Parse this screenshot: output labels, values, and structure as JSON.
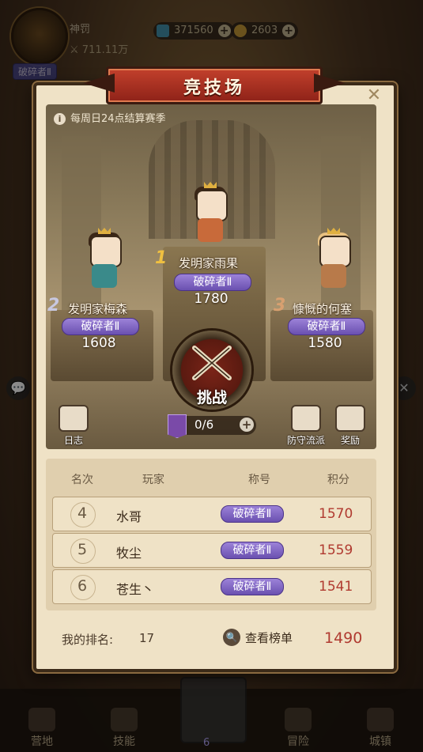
{
  "hud": {
    "player_name": "神罚",
    "power": "711.11万",
    "rank_badge": "破碎者Ⅱ",
    "gems": "371560",
    "coins": "2603"
  },
  "dialog": {
    "title": "竞技场",
    "close_symbol": "✕",
    "season_note": "每周日24点结算赛季",
    "podium": [
      {
        "place": "1",
        "name": "发明家雨果",
        "title": "破碎者Ⅱ",
        "score": "1780"
      },
      {
        "place": "2",
        "name": "发明家梅森",
        "title": "破碎者Ⅱ",
        "score": "1608"
      },
      {
        "place": "3",
        "name": "慷慨的何塞",
        "title": "破碎者Ⅱ",
        "score": "1580"
      }
    ],
    "challenge_label": "挑战",
    "tickets": "0/6",
    "log_label": "日志",
    "defense_label": "防守流派",
    "reward_label": "奖励",
    "table": {
      "headers": {
        "rank": "名次",
        "player": "玩家",
        "title": "称号",
        "score": "积分"
      },
      "rows": [
        {
          "rank": "4",
          "player": "水哥",
          "title": "破碎者Ⅱ",
          "score": "1570"
        },
        {
          "rank": "5",
          "player": "牧尘",
          "title": "破碎者Ⅱ",
          "score": "1559"
        },
        {
          "rank": "6",
          "player": "苍生丶",
          "title": "破碎者Ⅱ",
          "score": "1541"
        }
      ]
    },
    "my_rank_label": "我的排名:",
    "my_rank": "17",
    "view_board_label": "查看榜单",
    "my_score": "1490"
  },
  "bottom_nav": {
    "camp": "营地",
    "skills": "技能",
    "adventure": "冒险",
    "town": "城镇",
    "center_count": "6"
  },
  "colors": {
    "title_banner": "#b03a2a",
    "pill_purple": "#8a6ed0",
    "score_red": "#b03a30",
    "panel_parchment": "#efe2c6"
  }
}
